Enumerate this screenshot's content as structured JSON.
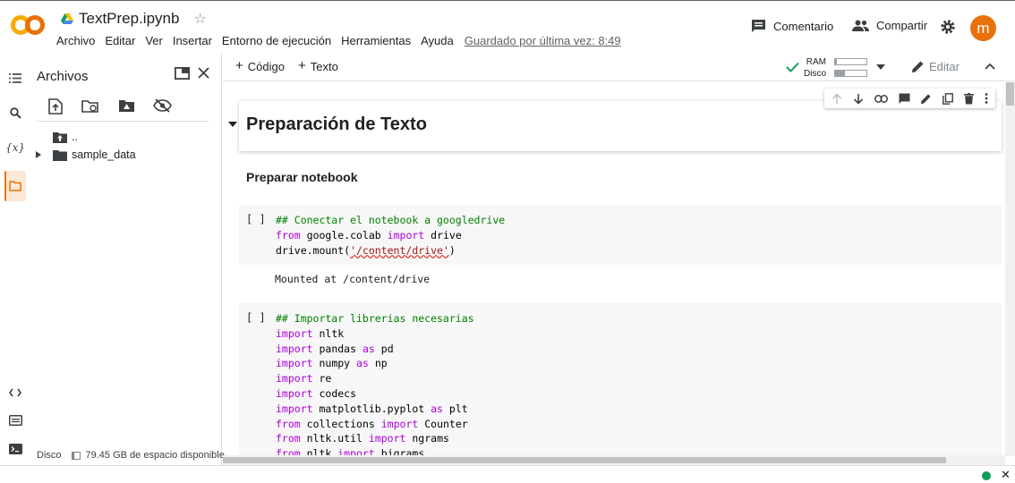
{
  "app": {
    "logo_text": "CO",
    "notebook_name": "TextPrep.ipynb",
    "menu": [
      "Archivo",
      "Editar",
      "Ver",
      "Insertar",
      "Entorno de ejecución",
      "Herramientas",
      "Ayuda"
    ],
    "saved_status": "Guardado por última vez: 8:49",
    "comment_label": "Comentario",
    "share_label": "Compartir",
    "avatar_letter": "m",
    "accent_color": "#e8710a"
  },
  "files_panel": {
    "title": "Archivos",
    "tree": [
      {
        "label": "..",
        "type": "parent-folder"
      },
      {
        "label": "sample_data",
        "type": "folder"
      }
    ],
    "disk_label": "Disco",
    "disk_free": "79.45 GB de espacio disponible"
  },
  "toolbar": {
    "add_code": "Código",
    "add_text": "Texto",
    "ram_label": "RAM",
    "disk_label": "Disco",
    "ram_fill": 0.06,
    "disk_fill": 0.3,
    "edit_label": "Editar"
  },
  "notebook": {
    "heading1": "Preparación de Texto",
    "heading2": "Preparar notebook",
    "cell1": {
      "run_indicator": "[ ]",
      "comment": "## Conectar el notebook a googledrive",
      "line2_kw1": "from",
      "line2_mod": "google.colab",
      "line2_kw2": "import",
      "line2_name": "drive",
      "line3_pre": "drive.mount(",
      "line3_str": "'/content/drive'",
      "line3_post": ")",
      "output": "Mounted at /content/drive"
    },
    "cell2": {
      "run_indicator": "[ ]",
      "comment": "## Importar librerias necesarias",
      "lines": [
        {
          "kw1": "import",
          "mod": "nltk",
          "kw2": "",
          "name": ""
        },
        {
          "kw1": "import",
          "mod": "pandas",
          "kw2": "as",
          "name": "pd"
        },
        {
          "kw1": "import",
          "mod": "numpy",
          "kw2": "as",
          "name": "np"
        },
        {
          "kw1": "import",
          "mod": "re",
          "kw2": "",
          "name": ""
        },
        {
          "kw1": "import",
          "mod": "codecs",
          "kw2": "",
          "name": ""
        },
        {
          "kw1": "import",
          "mod": "matplotlib.pyplot",
          "kw2": "as",
          "name": "plt"
        },
        {
          "kw1": "from",
          "mod": "collections",
          "kw2": "import",
          "name": "Counter"
        },
        {
          "kw1": "from",
          "mod": "nltk.util",
          "kw2": "import",
          "name": "ngrams"
        },
        {
          "kw1": "from",
          "mod": "nltk",
          "kw2": "import",
          "name": "bigrams"
        }
      ]
    }
  }
}
